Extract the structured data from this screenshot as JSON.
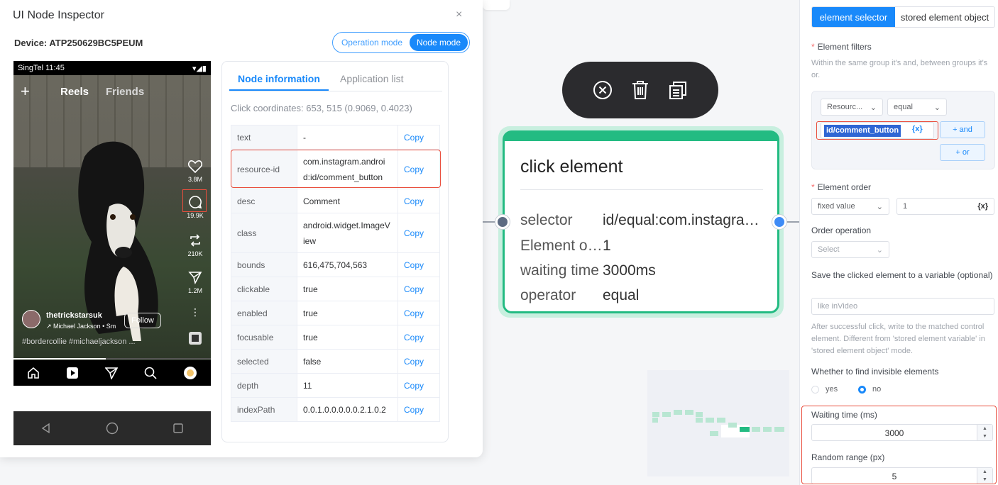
{
  "inspector": {
    "title": "UI Node Inspector",
    "close_label": "×",
    "device_label": "Device: ATP250629BC5PEUM",
    "mode_operation": "Operation mode",
    "mode_node": "Node mode"
  },
  "phone": {
    "status_left": "SingTel 11:45",
    "reels_plus": "+",
    "reels_tab": "Reels",
    "friends_tab": "Friends",
    "likes": "3.8M",
    "comments": "19.9K",
    "reposts": "210K",
    "shares": "1.2M",
    "author": "thetrickstarsuk",
    "song": "↗ Michael Jackson • Sm",
    "follow": "Follow",
    "hashtags": "#bordercollie #michaeljackson ..."
  },
  "info_panel": {
    "tab_node": "Node information",
    "tab_apps": "Application list",
    "click_coords": "Click coordinates: 653, 515 (0.9069, 0.4023)",
    "copy_label": "Copy",
    "rows": [
      {
        "key": "text",
        "value": "-"
      },
      {
        "key": "resource-id",
        "value": "com.instagram.android:id/comment_button"
      },
      {
        "key": "desc",
        "value": "Comment"
      },
      {
        "key": "class",
        "value": "android.widget.ImageView"
      },
      {
        "key": "bounds",
        "value": "616,475,704,563"
      },
      {
        "key": "clickable",
        "value": "true"
      },
      {
        "key": "enabled",
        "value": "true"
      },
      {
        "key": "focusable",
        "value": "true"
      },
      {
        "key": "selected",
        "value": "false"
      },
      {
        "key": "depth",
        "value": "11"
      },
      {
        "key": "indexPath",
        "value": "0.0.1.0.0.0.0.0.2.1.0.2"
      }
    ]
  },
  "node": {
    "title": "click element",
    "rows": [
      {
        "key": "selector",
        "value": "id/equal:com.instagram.android:id/comment_button"
      },
      {
        "key": "Element order",
        "value": "1"
      },
      {
        "key": "waiting time",
        "value": "3000ms"
      },
      {
        "key": "operator",
        "value": "equal"
      }
    ]
  },
  "settings": {
    "tab_selector": "element selector",
    "tab_stored": "stored element object",
    "filters_label": "Element filters",
    "filters_hint": "Within the same group it's and, between groups it's or.",
    "filter_field": "Resourc...",
    "filter_op": "equal",
    "filter_value": "id/comment_button",
    "filter_var": "{x}",
    "and_btn": "+ and",
    "or_btn": "+ or",
    "order_label": "Element order",
    "order_mode": "fixed value",
    "order_value": "1",
    "order_var": "{x}",
    "op_label": "Order operation",
    "op_placeholder": "Select",
    "save_label": "Save the clicked element to a variable (optional)",
    "save_placeholder": "like inVideo",
    "save_hint": "After successful click, write to the matched control element. Different from 'stored element variable' in 'stored element object' mode.",
    "invisible_label": "Whether to find invisible elements",
    "yes": "yes",
    "no": "no",
    "invisible_value": "no",
    "wait_label": "Waiting time (ms)",
    "wait_value": "3000",
    "range_label": "Random range (px)",
    "range_value": "5"
  },
  "colors": {
    "accent": "#1989fa",
    "node_green": "#23bb82",
    "highlight_red": "#e94e3d",
    "toolbar_dark": "#2b2b2e"
  },
  "icons": {
    "toolbar": [
      "close-circle-icon",
      "trash-icon",
      "copy-icon"
    ]
  }
}
